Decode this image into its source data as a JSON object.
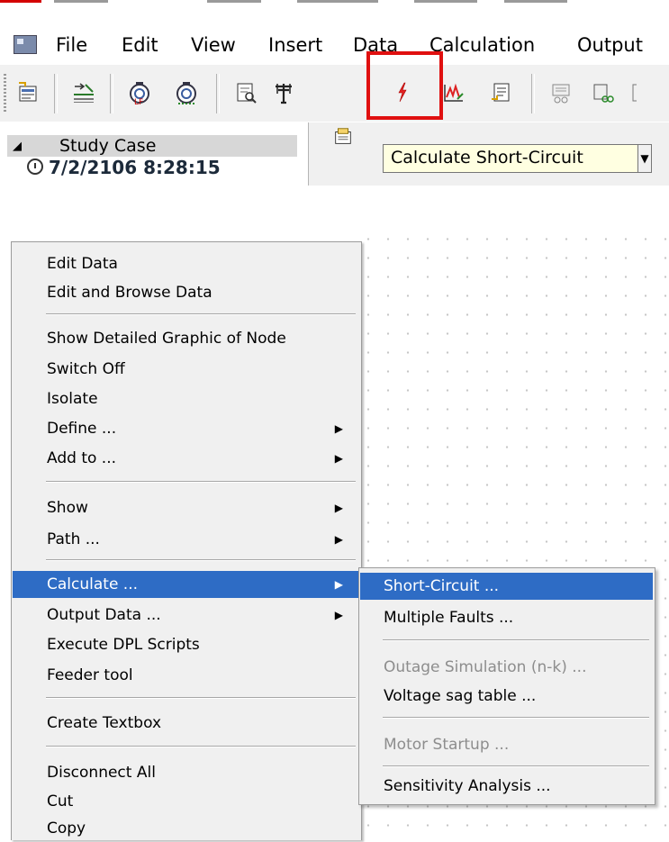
{
  "menubar": {
    "items": [
      "File",
      "Edit",
      "View",
      "Insert",
      "Data",
      "Calculation",
      "Output"
    ]
  },
  "study_case": {
    "label": "Study Case",
    "timestamp": "7/2/2106 8:28:15"
  },
  "tooltip": "Calculate Short-Circuit",
  "context_menu": {
    "items": [
      {
        "label": "Edit Data"
      },
      {
        "label": "Edit and Browse Data"
      },
      {
        "label": "Show Detailed Graphic of Node"
      },
      {
        "label": "Switch Off"
      },
      {
        "label": "Isolate"
      },
      {
        "label": "Define ..."
      },
      {
        "label": "Add to ..."
      },
      {
        "label": "Show"
      },
      {
        "label": "Path ..."
      },
      {
        "label": "Calculate ..."
      },
      {
        "label": "Output Data ..."
      },
      {
        "label": "Execute DPL Scripts"
      },
      {
        "label": "Feeder tool"
      },
      {
        "label": "Create Textbox"
      },
      {
        "label": "Disconnect All"
      },
      {
        "label": "Cut"
      },
      {
        "label": "Copy"
      }
    ]
  },
  "submenu": {
    "items": [
      {
        "label": "Short-Circuit ..."
      },
      {
        "label": "Multiple Faults ..."
      },
      {
        "label": "Outage Simulation (n-k) ..."
      },
      {
        "label": "Voltage sag table ..."
      },
      {
        "label": "Motor Startup ..."
      },
      {
        "label": "Sensitivity Analysis ..."
      }
    ]
  },
  "colors": {
    "selection": "#2e6cc5",
    "highlight_box": "#e01010",
    "tooltip_bg": "#ffffe1"
  }
}
